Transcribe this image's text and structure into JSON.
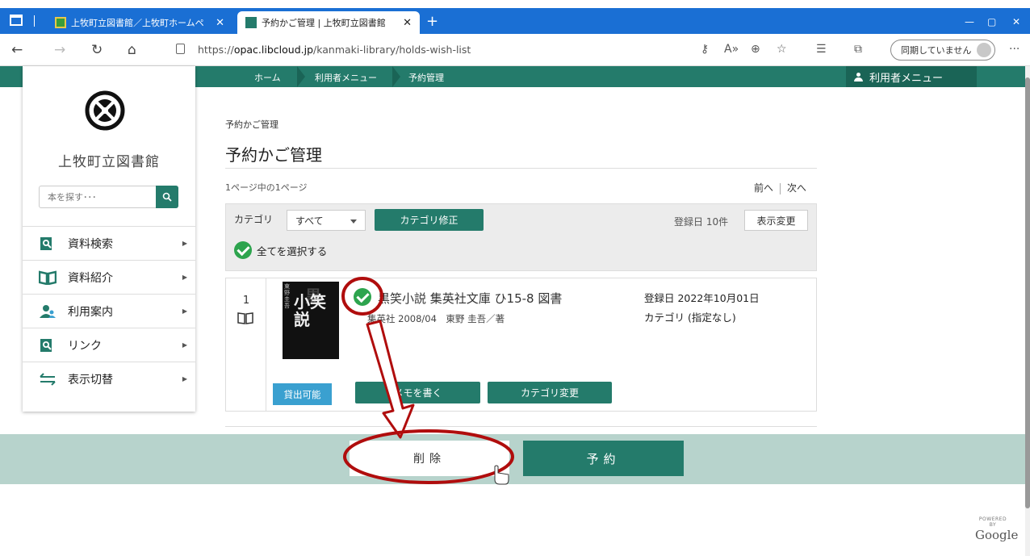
{
  "browser": {
    "tabs": [
      {
        "label": "上牧町立図書館／上牧町ホームペ"
      },
      {
        "label": "予約かご管理 | 上牧町立図書館"
      }
    ],
    "url_prefix": "https://",
    "url_host": "opac.libcloud.jp",
    "url_path": "/kanmaki-library/holds-wish-list",
    "sync_label": "同期していません"
  },
  "header": {
    "breadcrumbs": [
      "ホーム",
      "利用者メニュー",
      "予約管理"
    ],
    "user_menu_label": "利用者メニュー"
  },
  "sidebar": {
    "library_name": "上牧町立図書館",
    "search_placeholder": "本を探す･･･",
    "items": [
      {
        "label": "資料検索",
        "icon": "search-doc-icon"
      },
      {
        "label": "資料紹介",
        "icon": "open-book-icon"
      },
      {
        "label": "利用案内",
        "icon": "users-icon"
      },
      {
        "label": "リンク",
        "icon": "search-doc-icon"
      },
      {
        "label": "表示切替",
        "icon": "switch-arrows-icon"
      }
    ]
  },
  "main": {
    "breadcrumb": "予約かご管理",
    "title": "予約かご管理",
    "page_info": "1ページ中の1ページ",
    "prev_label": "前へ",
    "next_label": "次へ",
    "category_label": "カテゴリ",
    "category_selected": "すべて",
    "category_fix_label": "カテゴリ修正",
    "sort_info": "登録日 10件",
    "display_change_label": "表示変更",
    "select_all_label": "全てを選択する",
    "items": [
      {
        "index": "1",
        "title": "黒笑小説 集英社文庫 ひ15-8 図書",
        "publisher": "集英社 2008/04　東野 圭吾／著",
        "registered": "登録日 2022年10月01日",
        "category": "カテゴリ (指定なし)",
        "lend_status": "貸出可能",
        "memo_label": "メモを書く",
        "category_change_label": "カテゴリ変更",
        "cover_text_top": "黒",
        "cover_text_main": "小笑説",
        "cover_author": "東野圭吾"
      }
    ],
    "delete_label": "削除",
    "reserve_label": "予約"
  },
  "footer": {
    "powered_by": "POWERED BY",
    "google": "Google"
  },
  "colors": {
    "brand": "#247b6b",
    "browser_bar": "#1a6fd4",
    "action_bar": "#b7d3cc",
    "annotation": "#b00d0d",
    "check": "#2da44e",
    "lend": "#3aa0d0"
  }
}
